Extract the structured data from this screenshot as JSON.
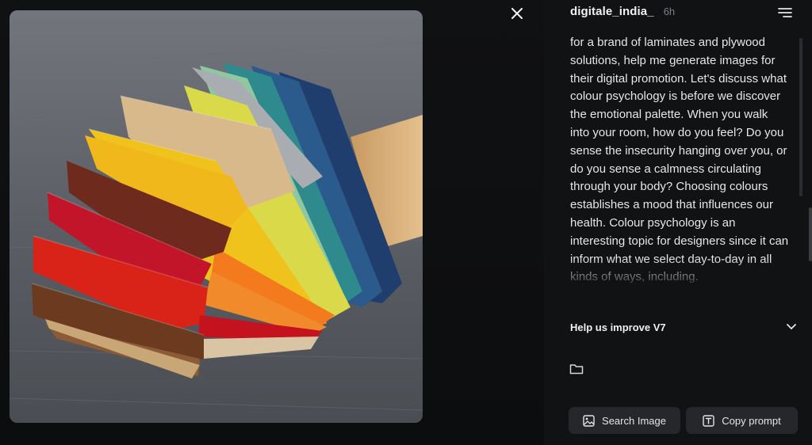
{
  "post": {
    "username": "digitale_india_",
    "timestamp": "6h",
    "prompt": "for a brand of laminates and plywood solutions, help me generate images for their digital promotion. Let's discuss what colour psychology is before we discover the emotional palette. When you walk into your room, how do you feel? Do you sense the insecurity hanging over you, or do you sense a calmness circulating through your body? Choosing colours establishes a mood that influences our health. Colour psychology is an interesting topic for designers since it can inform what we select day-to-day in all kinds of ways, including."
  },
  "feedback": {
    "label": "Help us improve V7"
  },
  "actions": {
    "search_image_label": "Search Image",
    "copy_prompt_label": "Copy prompt"
  },
  "icons": {
    "close": "close-icon",
    "menu": "menu-lines-icon",
    "chevron": "chevron-down-icon",
    "folder": "folder-icon",
    "image": "image-icon",
    "text": "text-icon"
  },
  "colors": {
    "background": "#0d0e10",
    "panel": "#111214",
    "button": "#26272b",
    "muted_text": "#7d7f85"
  }
}
